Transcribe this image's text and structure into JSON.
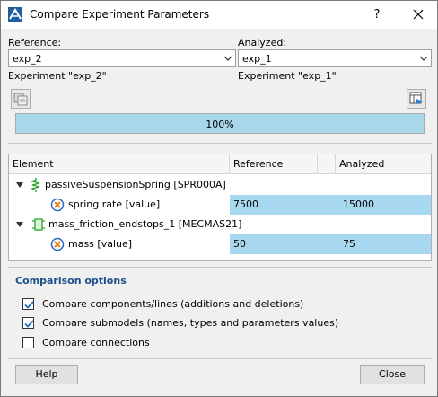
{
  "window": {
    "title": "Compare Experiment Parameters",
    "help_label": "?",
    "close_icon": "close-icon"
  },
  "reference": {
    "label": "Reference:",
    "value": "exp_2",
    "caption": "Experiment \"exp_2\""
  },
  "analyzed": {
    "label": "Analyzed:",
    "value": "exp_1",
    "caption": "Experiment \"exp_1\""
  },
  "progress": {
    "text": "100%",
    "fraction": 1.0
  },
  "table": {
    "columns": [
      "Element",
      "Reference",
      "Analyzed"
    ],
    "rows": [
      {
        "kind": "component",
        "label": "passiveSuspensionSpring [SPR000A]"
      },
      {
        "kind": "parameter",
        "label": "spring rate [value]",
        "reference": "7500",
        "analyzed": "15000"
      },
      {
        "kind": "component",
        "label": "mass_friction_endstops_1 [MECMAS21]"
      },
      {
        "kind": "parameter",
        "label": "mass [value]",
        "reference": "50",
        "analyzed": "75"
      }
    ]
  },
  "options": {
    "title": "Comparison options",
    "items": [
      {
        "label": "Compare components/lines (additions and deletions)",
        "checked": true
      },
      {
        "label": "Compare submodels (names, types and parameters values)",
        "checked": true
      },
      {
        "label": "Compare connections",
        "checked": false
      }
    ]
  },
  "buttons": {
    "help": "Help",
    "close": "Close"
  },
  "colors": {
    "highlight": "#a8d8f0",
    "progress": "#a8d8ea",
    "options_title": "#1a4f8a",
    "check": "#1a6fc0"
  }
}
